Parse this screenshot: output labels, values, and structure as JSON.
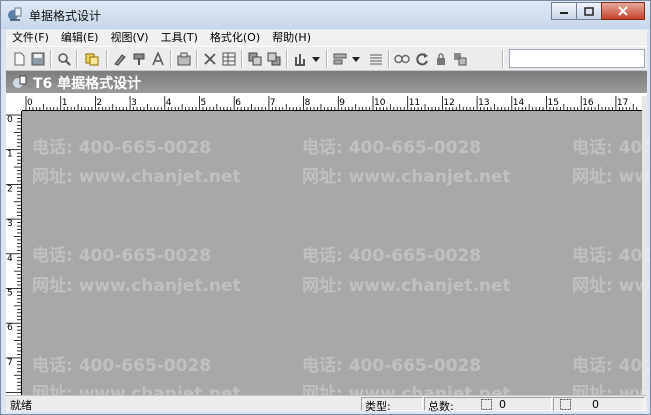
{
  "window": {
    "title": "单据格式设计"
  },
  "menu": [
    "文件(F)",
    "编辑(E)",
    "视图(V)",
    "工具(T)",
    "格式化(O)",
    "帮助(H)"
  ],
  "toolbar": {
    "icons": [
      "new-icon",
      "save-icon",
      "print-preview-icon",
      "copy-icon",
      "brush-icon",
      "format-painter-icon",
      "font-icon",
      "properties-icon",
      "delete-icon",
      "table-icon",
      "move-front-icon",
      "move-back-icon",
      "align-icon",
      "distribute-icon",
      "justify-icon",
      "link-icon",
      "refresh-icon",
      "lock-icon",
      "group-icon"
    ],
    "search_value": ""
  },
  "banner": {
    "title": "T6 单据格式设计"
  },
  "ruler": {
    "top_labels": [
      "0",
      "1",
      "2",
      "3",
      "4",
      "5",
      "6",
      "7",
      "8",
      "9",
      "10",
      "11",
      "12",
      "13",
      "14",
      "15",
      "16",
      "17"
    ],
    "left_labels": [
      "0",
      "1",
      "2",
      "3",
      "4",
      "5",
      "6",
      "7"
    ]
  },
  "watermark": {
    "phone": "电话: 400-665-0028",
    "site": "网址: www.chanjet.net"
  },
  "status": {
    "ready": "就绪",
    "type_label": "类型:",
    "total_label": "总数:",
    "count_a": "0",
    "count_b": "0"
  }
}
